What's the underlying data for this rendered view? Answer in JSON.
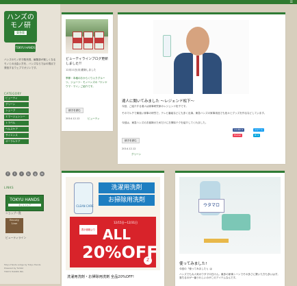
{
  "sidebar": {
    "logo_title": "ハンズの\nモノ研",
    "logo_sub": "東急版",
    "logo_badge": "TOKYU HANDS",
    "description": "ハンズのモノ好き販売員、編集部が楽しくなるモノとの出会い方を、ハンズならではの視点で発信するウェブマガジンです。",
    "category_title": "CATEGORY",
    "categories": [
      "ビューティ",
      "グリーン",
      "シェーブ",
      "エマージェンシー",
      "トラベル",
      "ヘルスケア",
      "サイエンス",
      "オーラルケア"
    ],
    "social_icons": [
      "facebook-icon",
      "twitter-icon",
      "rss-icon",
      "bookmark-icon",
      "google-icon",
      "mail-icon"
    ],
    "links_title": "LINKS",
    "tokyu_link_text": "TOKYU HANDS",
    "tokyu_link_sub": "ネットストア",
    "tokyu_link_label": "ショップ一覧",
    "beauty_text": "Beauty\nLine",
    "beauty_label": "ビューティライン",
    "footer": "Tokyu Hands Lodge by Tokyu Hands\nPowered by Tumblr\nTOKYU HANDS INC."
  },
  "cards": [
    {
      "title": "ビューティラインブログ更新しました!!",
      "date": "12月11日(月)更新しました",
      "link": "季節・本格のおからくり入りグルーツ。ジョーツ：モノハンズの「ケンヤウマ・マイ」ご紹介です。",
      "more_label": "続きを読む",
      "meta": "2014.12.12",
      "tag": "ビューティ"
    },
    {
      "title": "達人に聞いてみました ～レジェンド松下～",
      "body": [
        "今回、ご紹介する達人は家事研究家のレジェンド松下です。",
        "そのマルチで最強い家事の研究で、テレビ番組などにも多く出演。東急ハンズの家事用品でも色々とグッズを作るなどしています。",
        "今回は、東急ハンズのお客様のためだけにお掃除テクを紹介してくれました。"
      ],
      "more_label": "続きを読む",
      "meta": "2014.12.12",
      "tag": "グリーン",
      "sns": [
        "いいね! 0",
        "ツイート",
        "Pocket",
        "B! 0"
      ]
    },
    {
      "ad_bottle_text": "CLEAN CARE",
      "ad_head1": "洗濯用洗剤",
      "ad_head2": "お掃除用洗剤",
      "ad_date": "12/15日～12/31日",
      "ad_sale_label": "表示価格より",
      "ad_all": "ALL",
      "ad_off": "20%OFF",
      "ad_logo": "Z",
      "title": "洗濯用洗剤・お掃除用洗剤 全品20%OFF!"
    },
    {
      "bottle_label": "ウタマロ",
      "title": "使ってみました!",
      "body": [
        "今回の「使ってみました!」は",
        "ハンズでも大人気のウタマロ石けん。最多の家事シーンでその多さに驚いた方も多いはず。落ちるのが一番うれしいのがこのアイテムなんです。"
      ]
    }
  ]
}
